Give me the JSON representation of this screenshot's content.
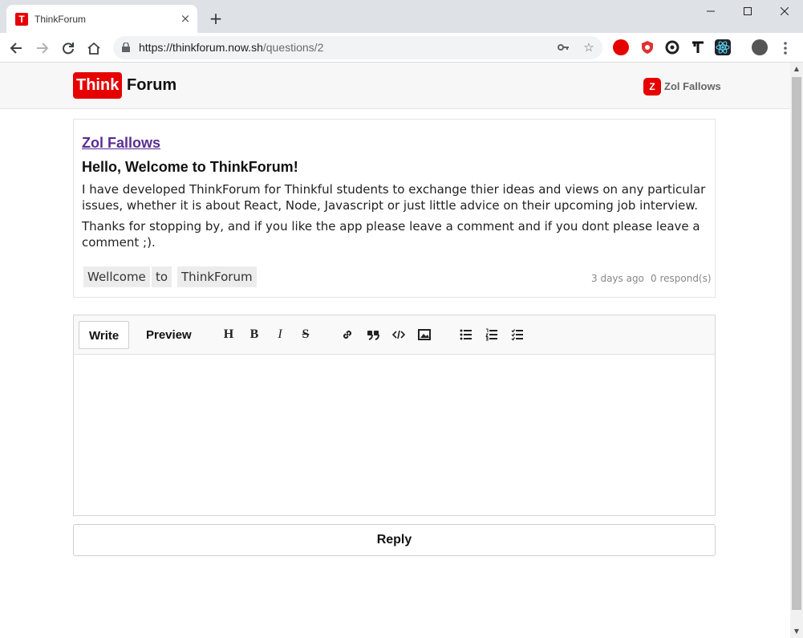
{
  "browser": {
    "tab_title": "ThinkForum",
    "tab_favicon_letter": "T",
    "url_host": "https://thinkforum.now.sh",
    "url_path": "/questions/2",
    "newtab_symbol": "+",
    "close_symbol": "×",
    "minimize_symbol": "—",
    "maximize_symbol": "☐",
    "window_close_symbol": "✕"
  },
  "header": {
    "logo_think": "Think",
    "logo_forum": "Forum",
    "user_initial": "Z",
    "user_name": "Zol Fallows",
    "brand_color": "#e60000"
  },
  "question": {
    "author": "Zol Fallows",
    "title": "Hello, Welcome to ThinkForum!",
    "paragraphs": [
      "I have developed ThinkForum for Thinkful students to exchange thier ideas and views on any particular issues, whether it is about React, Node, Javascript or just little advice on their upcoming job interview.",
      "Thanks for stopping by, and if you like the app please leave a comment and if you dont please leave a comment ;)."
    ],
    "tags": [
      "Wellcome",
      "to",
      "ThinkForum"
    ],
    "time_ago": "3 days ago",
    "responses": "0 respond(s)"
  },
  "editor": {
    "tab_write": "Write",
    "tab_preview": "Preview",
    "tools": [
      "header-icon",
      "bold-icon",
      "italic-icon",
      "strikethrough-icon",
      "link-icon",
      "quote-icon",
      "code-icon",
      "image-icon",
      "unordered-list-icon",
      "ordered-list-icon",
      "checklist-icon"
    ],
    "tool_labels": {
      "header": "H",
      "bold": "B",
      "italic": "I",
      "strike": "S"
    },
    "content": ""
  },
  "reply": {
    "label": "Reply"
  }
}
